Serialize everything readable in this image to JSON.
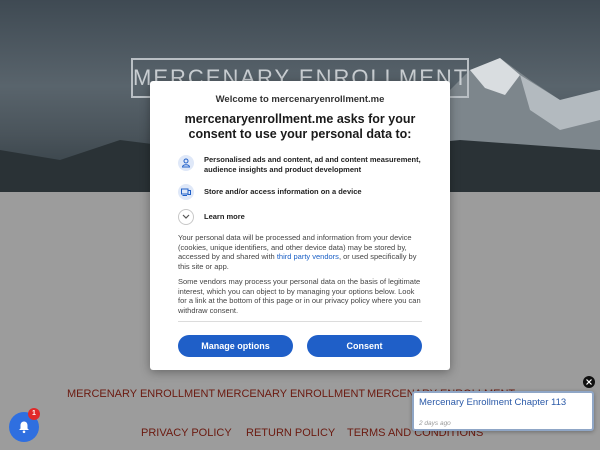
{
  "hero": {
    "title": "MERCENARY ENROLLMENT"
  },
  "nav_primary": [
    "MERCENARY ENROLLMENT",
    "MERCENARY ENROLLMENT",
    "MERCENARY ENROLLMENT"
  ],
  "nav_footer": [
    "PRIVACY POLICY",
    "RETURN POLICY",
    "TERMS AND CONDITIONS"
  ],
  "dialog": {
    "welcome": "Welcome to mercenaryenrollment.me",
    "heading": "mercenaryenrollment.me asks for your consent to use your personal data to:",
    "purposes": [
      {
        "icon": "person-icon",
        "text": "Personalised ads and content, ad and content measurement, audience insights and product development"
      },
      {
        "icon": "device-icon",
        "text": "Store and/or access information on a device"
      }
    ],
    "learn_more": "Learn more",
    "para1_before": "Your personal data will be processed and information from your device (cookies, unique identifiers, and other device data) may be stored by, accessed by and shared with ",
    "para1_link": "third party vendors",
    "para1_after": ", or used specifically by this site or app.",
    "para2": "Some vendors may process your personal data on the basis of legitimate interest, which you can object to by managing your options below. Look for a link at the bottom of this page or in our privacy policy where you can withdraw consent.",
    "manage_label": "Manage options",
    "consent_label": "Consent"
  },
  "chat": {
    "badge_count": "1"
  },
  "notification": {
    "title": "Mercenary Enrollment Chapter 113",
    "time": "2 days ago"
  },
  "colors": {
    "accent": "#1f5fc8",
    "nav_link": "#6b1a10",
    "badge": "#e12a2a"
  }
}
